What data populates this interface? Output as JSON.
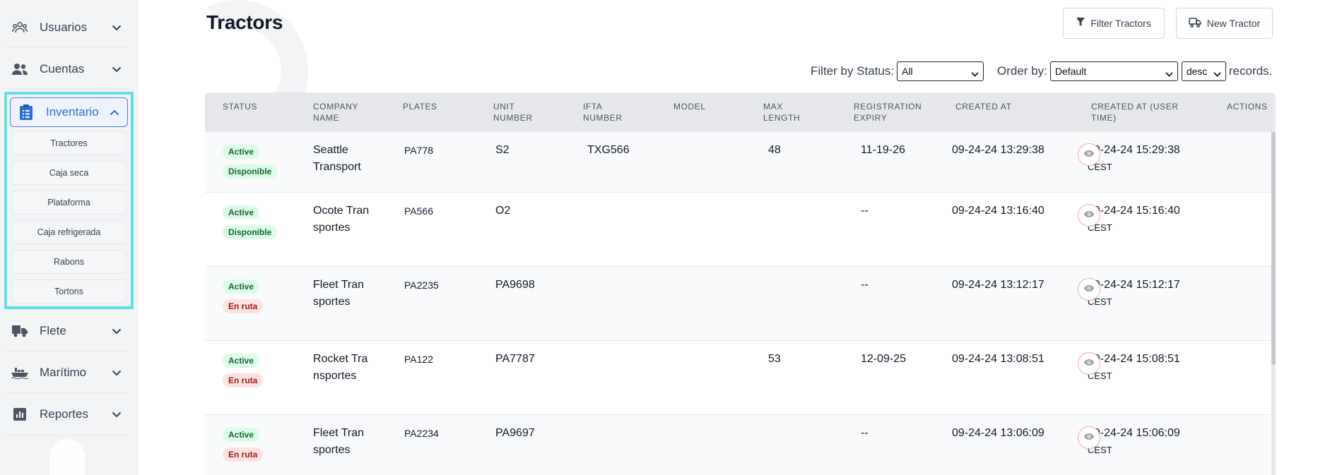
{
  "sidebar": {
    "items": [
      {
        "label": "Usuarios",
        "icon": "users-group-icon"
      },
      {
        "label": "Cuentas",
        "icon": "users-icon"
      },
      {
        "label": "Inventario",
        "icon": "clipboard-icon"
      },
      {
        "label": "Flete",
        "icon": "truck-icon"
      },
      {
        "label": "Marítimo",
        "icon": "ship-icon"
      },
      {
        "label": "Reportes",
        "icon": "chart-icon"
      }
    ],
    "inventario_sub": [
      "Tractores",
      "Caja seca",
      "Plataforma",
      "Caja refrigerada",
      "Rabons",
      "Tortons"
    ]
  },
  "header": {
    "title": "Tractors",
    "filter_button": "Filter Tractors",
    "new_button": "New Tractor"
  },
  "filters": {
    "status_label": "Filter by Status:",
    "status_value": "All",
    "order_label": "Order by:",
    "order_value": "Default",
    "direction_value": "desc",
    "records_label": "records."
  },
  "table": {
    "columns": [
      "STATUS",
      "COMPANY NAME",
      "PLATES",
      "UNIT NUMBER",
      "IFTA NUMBER",
      "MODEL",
      "MAX LENGTH",
      "REGISTRATION EXPIRY",
      "CREATED AT",
      "CREATED AT (USER TIME)",
      "ACTIONS"
    ],
    "rows": [
      {
        "status": "Active",
        "availability": "Disponible",
        "company": "Seattle Transport",
        "plates": "PA778",
        "unit": "S2",
        "ifta": "TXG566",
        "model": "",
        "max_length": "48",
        "reg_expiry": "11-19-26",
        "created": "09-24-24 13:29:38",
        "created_user": "09-24-24 15:29:38",
        "tz": "CEST"
      },
      {
        "status": "Active",
        "availability": "Disponible",
        "company": "Ocote Transportes",
        "plates": "PA566",
        "unit": "O2",
        "ifta": "",
        "model": "",
        "max_length": "",
        "reg_expiry": "--",
        "created": "09-24-24 13:16:40",
        "created_user": "09-24-24 15:16:40",
        "tz": "CEST"
      },
      {
        "status": "Active",
        "availability": "En ruta",
        "company": "Fleet Transportes",
        "plates": "PA2235",
        "unit": "PA9698",
        "ifta": "",
        "model": "",
        "max_length": "",
        "reg_expiry": "--",
        "created": "09-24-24 13:12:17",
        "created_user": "09-24-24 15:12:17",
        "tz": "CEST"
      },
      {
        "status": "Active",
        "availability": "En ruta",
        "company": "Rocket Transportes",
        "plates": "PA122",
        "unit": "PA7787",
        "ifta": "",
        "model": "",
        "max_length": "53",
        "reg_expiry": "12-09-25",
        "created": "09-24-24 13:08:51",
        "created_user": "09-24-24 15:08:51",
        "tz": "CEST"
      },
      {
        "status": "Active",
        "availability": "En ruta",
        "company": "Fleet Transportes",
        "plates": "PA2234",
        "unit": "PA9697",
        "ifta": "",
        "model": "",
        "max_length": "",
        "reg_expiry": "--",
        "created": "09-24-24 13:06:09",
        "created_user": "09-24-24 15:06:09",
        "tz": "CEST"
      }
    ]
  },
  "colors": {
    "accent": "#2b6ed8",
    "highlight": "#5ee0ea",
    "eye": "#e57373"
  }
}
